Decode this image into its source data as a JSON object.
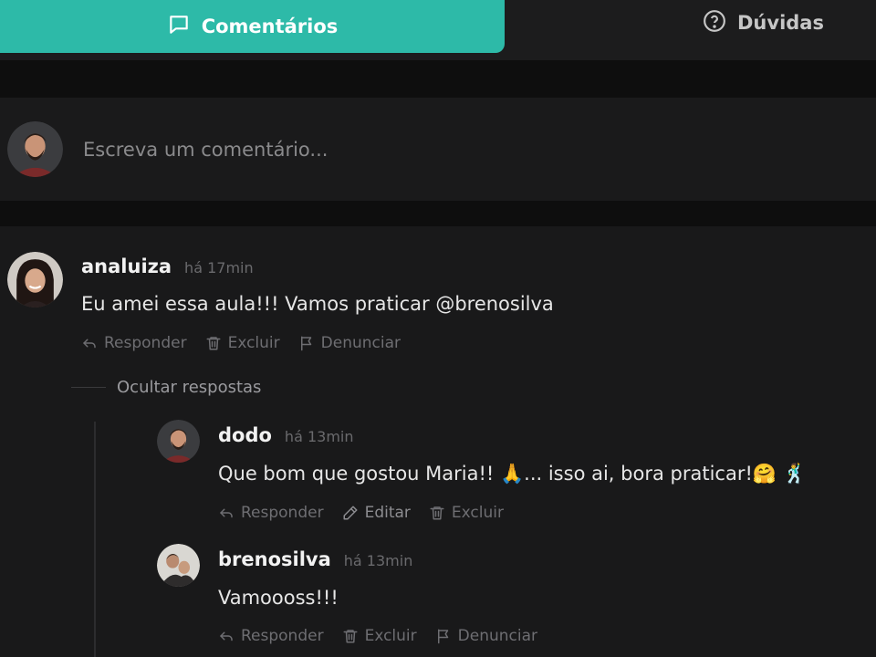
{
  "tabs": [
    {
      "label": "Comentários",
      "icon": "chat-bubble-icon",
      "active": true
    },
    {
      "label": "Dúvidas",
      "icon": "question-circle-icon",
      "active": false
    }
  ],
  "composer": {
    "placeholder": "Escreva um comentário..."
  },
  "comments": [
    {
      "username": "analuiza",
      "time": "há 17min",
      "text": "Eu amei essa aula!!! Vamos praticar @brenosilva",
      "actions": {
        "reply": "Responder",
        "delete": "Excluir",
        "report": "Denunciar"
      }
    }
  ],
  "thread": {
    "hide_label": "Ocultar respostas"
  },
  "replies": [
    {
      "username": "dodo",
      "time": "há 13min",
      "text": "Que bom que gostou Maria!! 🙏... isso ai, bora praticar!🤗 🕺",
      "actions": {
        "reply": "Responder",
        "edit": "Editar",
        "delete": "Excluir"
      }
    },
    {
      "username": "brenosilva",
      "time": "há 13min",
      "text": "Vamoooss!!!",
      "actions": {
        "reply": "Responder",
        "delete": "Excluir",
        "report": "Denunciar"
      }
    }
  ],
  "colors": {
    "accent": "#2dbaa8",
    "background": "#19191a"
  }
}
